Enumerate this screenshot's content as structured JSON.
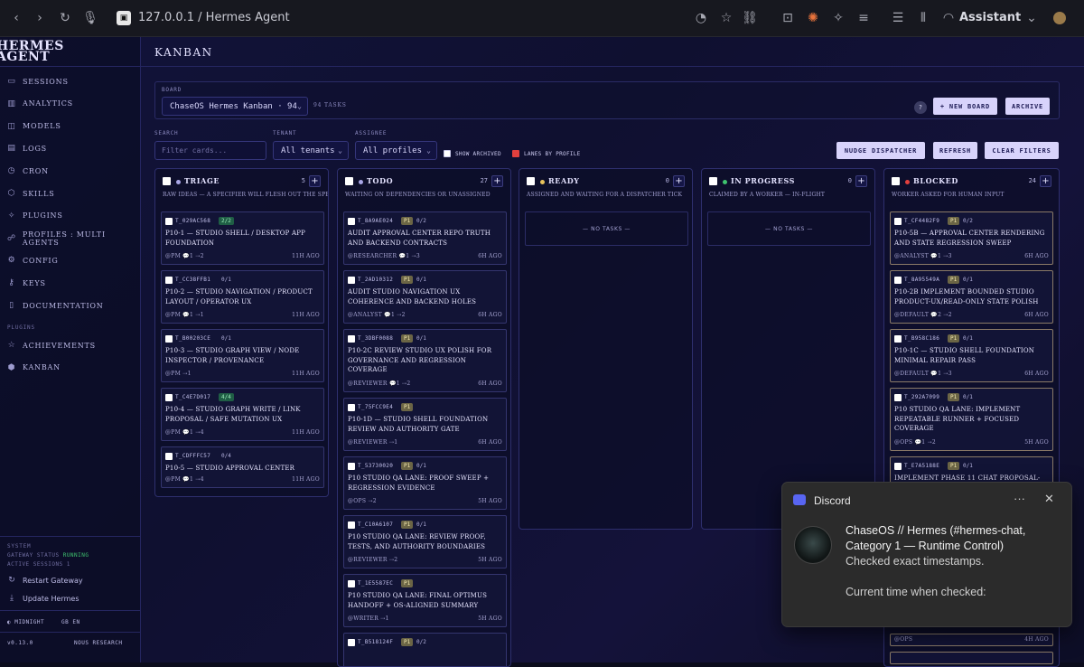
{
  "browser": {
    "url": "127.0.0.1 / Hermes Agent",
    "assistant_label": "Assistant"
  },
  "sidebar": {
    "logo": "HERMES AGENT",
    "items": [
      {
        "label": "SESSIONS",
        "icon": "chat-icon"
      },
      {
        "label": "ANALYTICS",
        "icon": "bar-chart-icon"
      },
      {
        "label": "MODELS",
        "icon": "layers-icon"
      },
      {
        "label": "LOGS",
        "icon": "document-icon"
      },
      {
        "label": "CRON",
        "icon": "clock-icon"
      },
      {
        "label": "SKILLS",
        "icon": "package-icon"
      },
      {
        "label": "PLUGINS",
        "icon": "puzzle-icon"
      },
      {
        "label": "PROFILES : MULTI AGENTS",
        "icon": "users-icon"
      },
      {
        "label": "CONFIG",
        "icon": "gear-icon"
      },
      {
        "label": "KEYS",
        "icon": "key-icon"
      },
      {
        "label": "DOCUMENTATION",
        "icon": "book-icon"
      }
    ],
    "plugins_heading": "PLUGINS",
    "plugin_items": [
      {
        "label": "ACHIEVEMENTS",
        "icon": "star-icon"
      },
      {
        "label": "KANBAN",
        "icon": "kanban-icon"
      }
    ],
    "system_heading": "SYSTEM",
    "gateway_status_label": "GATEWAY STATUS",
    "gateway_status_value": "RUNNING",
    "active_sessions": "ACTIVE SESSIONS 1",
    "restart_gateway": "Restart Gateway",
    "update_hermes": "Update Hermes",
    "theme": "MIDNIGHT",
    "lang_flag": "GB",
    "lang": "EN",
    "version": "v0.13.0",
    "credit": "NOUS RESEARCH"
  },
  "main": {
    "title": "KANBAN",
    "board_label": "BOARD",
    "board_value": "ChaseOS Hermes Kanban · 94",
    "board_tasks": "94 TASKS",
    "help": "?",
    "new_board": "+ NEW BOARD",
    "archive": "ARCHIVE",
    "search_label": "SEARCH",
    "search_placeholder": "Filter cards...",
    "tenant_label": "TENANT",
    "tenant_value": "All tenants",
    "assignee_label": "ASSIGNEE",
    "assignee_value": "All profiles",
    "show_archived": "SHOW ARCHIVED",
    "lanes_by_profile": "LANES BY PROFILE",
    "nudge": "NUDGE DISPATCHER",
    "refresh": "REFRESH",
    "clear_filters": "CLEAR FILTERS"
  },
  "columns": [
    {
      "name": "TRIAGE",
      "count": "5",
      "dot": "#a9a6e6",
      "desc": "RAW IDEAS — A SPECIFIER WILL FLESH OUT THE SPEC",
      "cards": [
        {
          "id": "T_029AC568",
          "badge": "2/2",
          "badge_type": "green",
          "title": "P10-1 — STUDIO SHELL / DESKTOP APP FOUNDATION",
          "meta": "@PM  💬1  ⇢2",
          "age": "11H AGO"
        },
        {
          "id": "T_CC38FFB1",
          "badge": "0/1",
          "badge_type": "plain",
          "title": "P10-2 — STUDIO NAVIGATION / PRODUCT LAYOUT / OPERATOR UX",
          "meta": "@PM  💬1  ⇢1",
          "age": "11H AGO"
        },
        {
          "id": "T_B00203CE",
          "badge": "0/1",
          "badge_type": "plain",
          "title": "P10-3 — STUDIO GRAPH VIEW / NODE INSPECTOR / PROVENANCE",
          "meta": "@PM  ⇢1",
          "age": "11H AGO"
        },
        {
          "id": "T_C4E7D017",
          "badge": "4/4",
          "badge_type": "green",
          "title": "P10-4 — STUDIO GRAPH WRITE / LINK PROPOSAL / SAFE MUTATION UX",
          "meta": "@PM  💬1  ⇢4",
          "age": "11H AGO"
        },
        {
          "id": "T_CDFFFC57",
          "badge": "0/4",
          "badge_type": "plain",
          "title": "P10-5 — STUDIO APPROVAL CENTER",
          "meta": "@PM  💬1  ⇢4",
          "age": "11H AGO"
        }
      ]
    },
    {
      "name": "TODO",
      "count": "27",
      "dot": "#a9a6e6",
      "desc": "WAITING ON DEPENDENCIES OR UNASSIGNED",
      "cards": [
        {
          "id": "T_8A9AE024",
          "p1": "P1",
          "badge": "0/2",
          "badge_type": "plain",
          "title": "AUDIT APPROVAL CENTER REPO TRUTH AND BACKEND CONTRACTS",
          "meta": "@RESEARCHER  💬1  ⇢3",
          "age": "6H AGO"
        },
        {
          "id": "T_2AD10312",
          "p1": "P1",
          "badge": "0/1",
          "badge_type": "plain",
          "title": "AUDIT STUDIO NAVIGATION UX COHERENCE AND BACKEND HOLES",
          "meta": "@ANALYST  💬1  ⇢2",
          "age": "6H AGO"
        },
        {
          "id": "T_3DBF0088",
          "p1": "P1",
          "badge": "0/1",
          "badge_type": "plain",
          "title": "P10-2C REVIEW STUDIO UX POLISH FOR GOVERNANCE AND REGRESSION COVERAGE",
          "meta": "@REVIEWER  💬1  ⇢2",
          "age": "6H AGO"
        },
        {
          "id": "T_75FCC9E4",
          "p1": "P1",
          "badge": "",
          "badge_type": "plain",
          "title": "P10-1D — STUDIO SHELL FOUNDATION REVIEW AND AUTHORITY GATE",
          "meta": "@REVIEWER  ⇢1",
          "age": "6H AGO"
        },
        {
          "id": "T_53730020",
          "p1": "P1",
          "badge": "0/1",
          "badge_type": "plain",
          "title": "P10 STUDIO QA LANE: PROOF SWEEP + REGRESSION EVIDENCE",
          "meta": "@OPS  ⇢2",
          "age": "5H AGO"
        },
        {
          "id": "T_C10A6107",
          "p1": "P1",
          "badge": "0/1",
          "badge_type": "plain",
          "title": "P10 STUDIO QA LANE: REVIEW PROOF, TESTS, AND AUTHORITY BOUNDARIES",
          "meta": "@REVIEWER  ⇢2",
          "age": "5H AGO"
        },
        {
          "id": "T_1E5587EC",
          "p1": "P1",
          "badge": "",
          "badge_type": "plain",
          "title": "P10 STUDIO QA LANE: FINAL OPTIMUS HANDOFF + OS-ALIGNED SUMMARY",
          "meta": "@WRITER  ⇢1",
          "age": "5H AGO"
        },
        {
          "id": "T_B518124F",
          "p1": "P1",
          "badge": "0/2",
          "badge_type": "plain",
          "title": "",
          "meta": "",
          "age": ""
        }
      ]
    },
    {
      "name": "READY",
      "count": "0",
      "dot": "#e8c35c",
      "desc": "ASSIGNED AND WAITING FOR A DISPATCHER TICK",
      "empty": "— NO TASKS —",
      "cards": []
    },
    {
      "name": "IN PROGRESS",
      "count": "0",
      "dot": "#3fc46f",
      "desc": "CLAIMED BY A WORKER — IN-FLIGHT",
      "empty": "— NO TASKS —",
      "cards": []
    },
    {
      "name": "BLOCKED",
      "count": "24",
      "dot": "#e2403e",
      "desc": "WORKER ASKED FOR HUMAN INPUT",
      "cards": [
        {
          "id": "T_CF4482F9",
          "p1": "P1",
          "badge": "0/2",
          "badge_type": "plain",
          "title": "P10-5B — APPROVAL CENTER RENDERING AND STATE REGRESSION SWEEP",
          "meta": "@ANALYST  💬1  ⇢3",
          "age": "6H AGO"
        },
        {
          "id": "T_8A95549A",
          "p1": "P1",
          "badge": "0/1",
          "badge_type": "plain",
          "title": "P10-2B IMPLEMENT BOUNDED STUDIO PRODUCT-UX/READ-ONLY STATE POLISH",
          "meta": "@DEFAULT  💬2  ⇢2",
          "age": "6H AGO"
        },
        {
          "id": "T_B958C186",
          "p1": "P1",
          "badge": "0/1",
          "badge_type": "plain",
          "title": "P10-1C — STUDIO SHELL FOUNDATION MINIMAL REPAIR PASS",
          "meta": "@DEFAULT  💬1  ⇢3",
          "age": "6H AGO"
        },
        {
          "id": "T_292A7099",
          "p1": "P1",
          "badge": "0/1",
          "badge_type": "plain",
          "title": "P10 STUDIO QA LANE: IMPLEMENT REPEATABLE RUNNER + FOCUSED COVERAGE",
          "meta": "@OPS  💬1  ⇢2",
          "age": "5H AGO"
        },
        {
          "id": "T_E7A5188E",
          "p1": "P1",
          "badge": "0/1",
          "badge_type": "plain",
          "title": "IMPLEMENT PHASE 11 CHAT PROPOSAL-",
          "meta": "",
          "age": ""
        }
      ],
      "tail_meta": "@OPS",
      "tail_age": "4H AGO"
    }
  ],
  "discord": {
    "app": "Discord",
    "more": "···",
    "close": "✕",
    "title": "ChaseOS // Hermes (#hermes-chat, Category 1 — Runtime Control)",
    "line1": "Checked exact timestamps.",
    "line2": "Current time when checked:"
  }
}
